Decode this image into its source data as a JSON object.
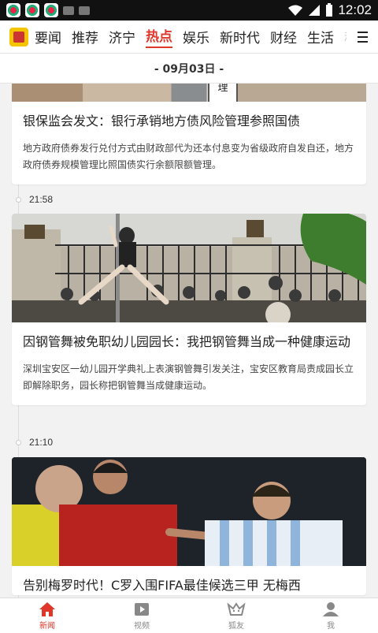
{
  "status_bar": {
    "time": "12:02"
  },
  "nav": {
    "tabs": [
      "要闻",
      "推荐",
      "济宁",
      "热点",
      "娱乐",
      "新时代",
      "财经",
      "生活",
      "科"
    ],
    "active_index": 3
  },
  "date_header": "- 09月03日 -",
  "feed": [
    {
      "time": "",
      "title": "银保监会发文：银行承销地方债风险管理参照国债",
      "summary": "地方政府债券发行兑付方式由财政部代为还本付息变为省级政府自发自还，地方政府债券规模管理比照国债实行余额限额管理。"
    },
    {
      "time": "21:58",
      "title": "因钢管舞被免职幼儿园园长：我把钢管舞当成一种健康运动",
      "summary": "深圳宝安区一幼儿园开学典礼上表演钢管舞引发关注，宝安区教育局责成园长立即解除职务，园长称把钢管舞当成健康运动。"
    },
    {
      "time": "21:10",
      "title": "告别梅罗时代！C罗入围FIFA最佳候选三甲 无梅西",
      "summary": ""
    }
  ],
  "image_1_sign_text": "管\n理",
  "bottom_nav": {
    "items": [
      {
        "label": "新闻",
        "icon": "home-icon"
      },
      {
        "label": "视频",
        "icon": "video-icon"
      },
      {
        "label": "狐友",
        "icon": "friends-icon"
      },
      {
        "label": "我",
        "icon": "user-icon"
      }
    ],
    "active_index": 0
  },
  "colors": {
    "accent": "#e0372b",
    "card_bg": "#ffffff",
    "page_bg": "#f2f2f2"
  }
}
